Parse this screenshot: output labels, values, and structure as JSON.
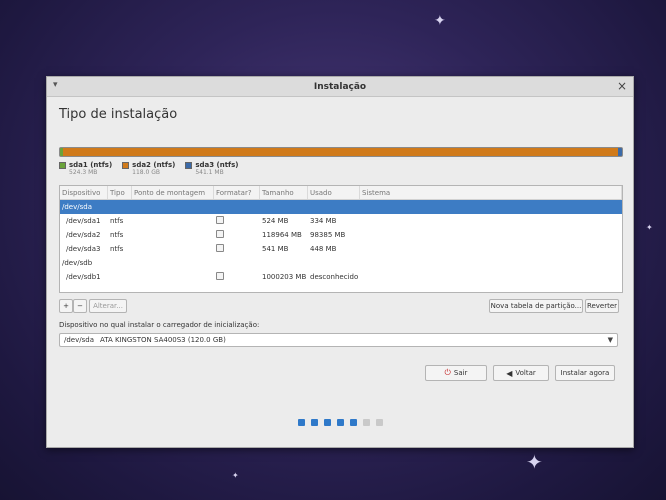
{
  "window": {
    "title": "Instalação",
    "page_title": "Tipo de instalação"
  },
  "partition_bar": {
    "colors": {
      "sda1": "#6aa33a",
      "sda2": "#d07a1a",
      "sda3": "#3b6aa8"
    },
    "legend": [
      {
        "label": "sda1 (ntfs)",
        "size": "524.3 MB"
      },
      {
        "label": "sda2 (ntfs)",
        "size": "118.0 GB"
      },
      {
        "label": "sda3 (ntfs)",
        "size": "541.1 MB"
      }
    ]
  },
  "table": {
    "headers": [
      "Dispositivo",
      "Tipo",
      "Ponto de montagem",
      "Formatar?",
      "Tamanho",
      "Usado",
      "Sistema"
    ],
    "rows": [
      {
        "device": "/dev/sda",
        "type": "",
        "size": "",
        "used": ""
      },
      {
        "device": "/dev/sda1",
        "type": "ntfs",
        "size": "524 MB",
        "used": "334 MB"
      },
      {
        "device": "/dev/sda2",
        "type": "ntfs",
        "size": "118964 MB",
        "used": "98385 MB"
      },
      {
        "device": "/dev/sda3",
        "type": "ntfs",
        "size": "541 MB",
        "used": "448 MB"
      },
      {
        "device": "/dev/sdb",
        "type": "",
        "size": "",
        "used": ""
      },
      {
        "device": "/dev/sdb1",
        "type": "",
        "size": "1000203 MB",
        "used": "desconhecido"
      }
    ]
  },
  "toolbar": {
    "add": "+",
    "remove": "−",
    "change": "Alterar...",
    "new_table": "Nova tabela de partição...",
    "revert": "Reverter"
  },
  "bootloader": {
    "label": "Dispositivo no qual instalar o carregador de inicialização:",
    "device": "/dev/sda",
    "description": "ATA KINGSTON SA400S3 (120.0 GB)"
  },
  "actions": {
    "quit": "Sair",
    "back": "Voltar",
    "install": "Instalar agora"
  },
  "progress": {
    "steps_done": 5,
    "steps_total": 7
  }
}
